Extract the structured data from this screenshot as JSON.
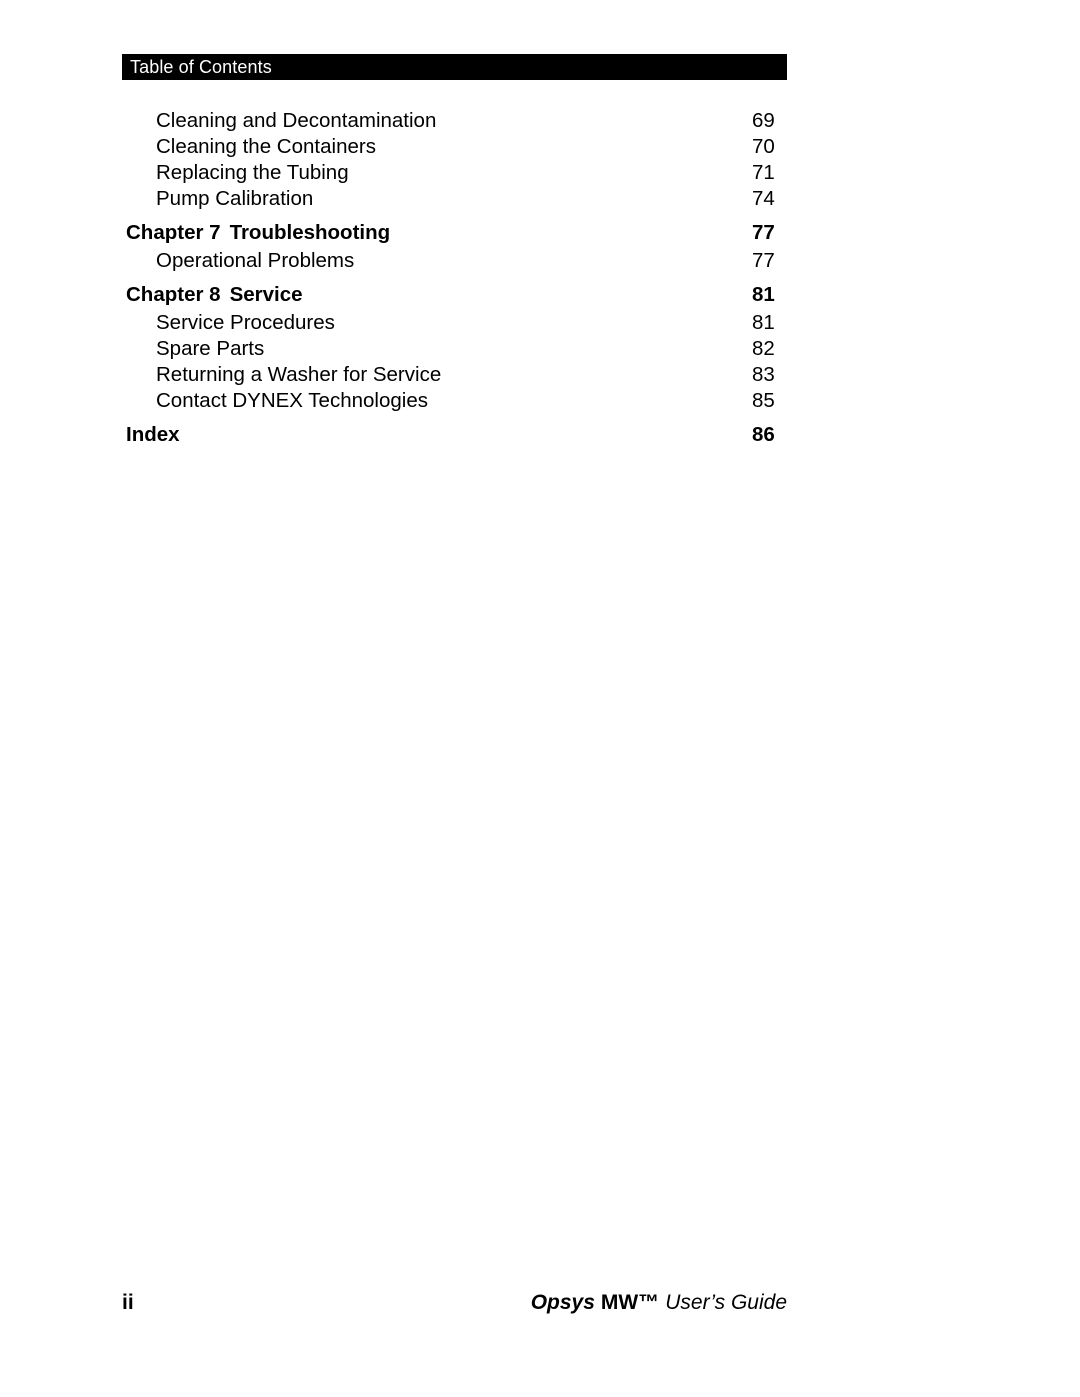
{
  "header": {
    "band_title": "Table of Contents"
  },
  "toc": {
    "entries": [
      {
        "level": "sub",
        "label": "Cleaning and Decontamination",
        "page": "69"
      },
      {
        "level": "sub",
        "label": "Cleaning the Containers",
        "page": "70"
      },
      {
        "level": "sub",
        "label": "Replacing the Tubing",
        "page": "71"
      },
      {
        "level": "sub",
        "label": "Pump Calibration",
        "page": "74"
      },
      {
        "level": "chapter",
        "chapter_label": "Chapter 7",
        "title": "Troubleshooting",
        "label": "Chapter 7  Troubleshooting",
        "page": "77"
      },
      {
        "level": "sub",
        "label": "Operational Problems",
        "page": "77"
      },
      {
        "level": "chapter",
        "chapter_label": "Chapter 8",
        "title": "Service",
        "label": "Chapter 8  Service",
        "page": "81"
      },
      {
        "level": "sub",
        "label": "Service Procedures",
        "page": "81"
      },
      {
        "level": "sub",
        "label": "Spare Parts",
        "page": "82"
      },
      {
        "level": "sub",
        "label": "Returning a Washer for Service",
        "page": "83"
      },
      {
        "level": "sub",
        "label": "Contact DYNEX Technologies",
        "page": "85"
      },
      {
        "level": "top",
        "label": "Index",
        "page": "86"
      }
    ]
  },
  "footer": {
    "page_number": "ii",
    "brand": "Opsys",
    "model": "MW™",
    "guide": "User’s Guide"
  },
  "colors": {
    "page_background": "#ffffff",
    "text": "#000000",
    "header_band_background": "#000000",
    "header_band_text": "#ffffff"
  }
}
